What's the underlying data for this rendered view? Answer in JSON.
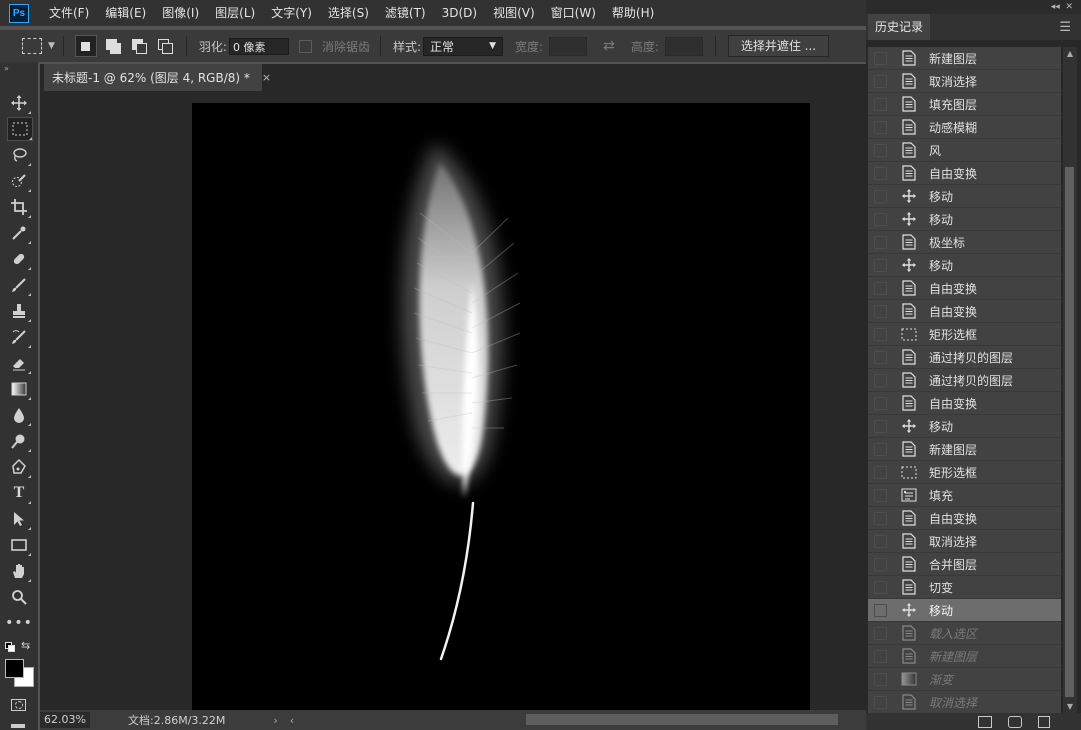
{
  "app": {
    "logo": "Ps"
  },
  "menu": [
    "文件(F)",
    "编辑(E)",
    "图像(I)",
    "图层(L)",
    "文字(Y)",
    "选择(S)",
    "滤镜(T)",
    "3D(D)",
    "视图(V)",
    "窗口(W)",
    "帮助(H)"
  ],
  "options": {
    "feather_label": "羽化:",
    "feather_value": "0 像素",
    "antialias_label": "消除锯齿",
    "style_label": "样式:",
    "style_value": "正常",
    "width_label": "宽度:",
    "height_label": "高度:",
    "select_mask_button": "选择并遮住 ..."
  },
  "document": {
    "tab_title": "未标题-1 @ 62% (图层 4, RGB/8) *",
    "close_glyph": "×"
  },
  "status": {
    "zoom": "62.03%",
    "doc_size": "文档:2.86M/3.22M",
    "arrow_right": "›",
    "arrow_left": "‹"
  },
  "history_panel": {
    "title": "历史记录",
    "items": [
      {
        "label": "新建图层",
        "icon": "doc-icon",
        "state": "normal"
      },
      {
        "label": "取消选择",
        "icon": "doc-icon",
        "state": "normal"
      },
      {
        "label": "填充图层",
        "icon": "doc-icon",
        "state": "normal"
      },
      {
        "label": "动感模糊",
        "icon": "doc-icon",
        "state": "normal"
      },
      {
        "label": "风",
        "icon": "doc-icon",
        "state": "normal"
      },
      {
        "label": "自由变换",
        "icon": "doc-icon",
        "state": "normal"
      },
      {
        "label": "移动",
        "icon": "move-icon",
        "state": "normal"
      },
      {
        "label": "移动",
        "icon": "move-icon",
        "state": "normal"
      },
      {
        "label": "极坐标",
        "icon": "doc-icon",
        "state": "normal"
      },
      {
        "label": "移动",
        "icon": "move-icon",
        "state": "normal"
      },
      {
        "label": "自由变换",
        "icon": "doc-icon",
        "state": "normal"
      },
      {
        "label": "自由变换",
        "icon": "doc-icon",
        "state": "normal"
      },
      {
        "label": "矩形选框",
        "icon": "marquee-icon",
        "state": "normal"
      },
      {
        "label": "通过拷贝的图层",
        "icon": "doc-icon",
        "state": "normal"
      },
      {
        "label": "通过拷贝的图层",
        "icon": "doc-icon",
        "state": "normal"
      },
      {
        "label": "自由变换",
        "icon": "doc-icon",
        "state": "normal"
      },
      {
        "label": "移动",
        "icon": "move-icon",
        "state": "normal"
      },
      {
        "label": "新建图层",
        "icon": "doc-icon",
        "state": "normal"
      },
      {
        "label": "矩形选框",
        "icon": "marquee-icon",
        "state": "normal"
      },
      {
        "label": "填充",
        "icon": "fill-icon",
        "state": "normal"
      },
      {
        "label": "自由变换",
        "icon": "doc-icon",
        "state": "normal"
      },
      {
        "label": "取消选择",
        "icon": "doc-icon",
        "state": "normal"
      },
      {
        "label": "合并图层",
        "icon": "doc-icon",
        "state": "normal"
      },
      {
        "label": "切变",
        "icon": "doc-icon",
        "state": "normal"
      },
      {
        "label": "移动",
        "icon": "move-icon",
        "state": "current"
      },
      {
        "label": "载入选区",
        "icon": "doc-icon",
        "state": "undone"
      },
      {
        "label": "新建图层",
        "icon": "doc-icon",
        "state": "undone"
      },
      {
        "label": "渐变",
        "icon": "gradient-icon",
        "state": "undone"
      },
      {
        "label": "取消选择",
        "icon": "doc-icon",
        "state": "undone"
      }
    ]
  },
  "colors": {
    "foreground": "#000000",
    "background": "#ffffff",
    "accent_logo": "#31a8ff"
  }
}
